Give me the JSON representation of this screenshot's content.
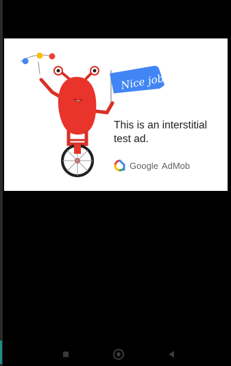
{
  "ad": {
    "banner_text": "Nice job!",
    "message_line1": "This is an interstitial",
    "message_line2": "test ad.",
    "brand_google": "Google",
    "brand_admob": "AdMob"
  },
  "colors": {
    "background": "#000000",
    "card": "#ffffff",
    "mascot_red": "#e8342b",
    "banner_blue": "#4285f4",
    "text": "#202124"
  },
  "navigation": {
    "icons": [
      "recents-square-icon",
      "home-circle-icon",
      "back-triangle-icon"
    ]
  }
}
